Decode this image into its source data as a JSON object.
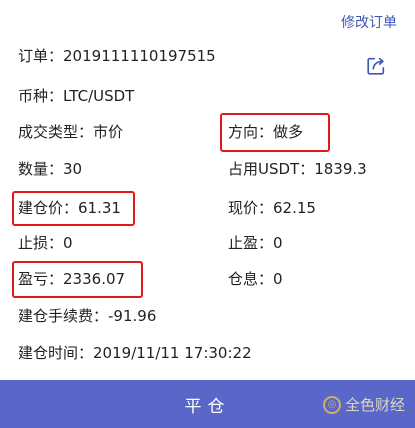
{
  "header": {
    "modify_order": "修改订单"
  },
  "icons": {
    "edit": "share-edit-icon"
  },
  "order": {
    "order_id": {
      "label": "订单：",
      "value": "2019111110197515"
    },
    "coin": {
      "label": "币种：",
      "value": "LTC/USDT"
    },
    "trade_type": {
      "label": "成交类型：",
      "value": "市价"
    },
    "direction": {
      "label": "方向：",
      "value": "做多"
    },
    "quantity": {
      "label": "数量：",
      "value": "30"
    },
    "usdt_used": {
      "label": "占用USDT：",
      "value": "1839.3"
    },
    "open_price": {
      "label": "建仓价：",
      "value": "61.31"
    },
    "current_price": {
      "label": "现价：",
      "value": "62.15"
    },
    "stop_loss": {
      "label": "止损：",
      "value": "0"
    },
    "take_profit": {
      "label": "止盈：",
      "value": "0"
    },
    "pnl": {
      "label": "盈亏：",
      "value": "2336.07"
    },
    "position_interest": {
      "label": "仓息：",
      "value": "0"
    },
    "open_fee": {
      "label": "建仓手续费：",
      "value": "-91.96"
    },
    "open_time": {
      "label": "建仓时间：",
      "value": "2019/11/11 17:30:22"
    }
  },
  "actions": {
    "close_position": "平仓"
  },
  "watermark": {
    "text": "全色财经"
  },
  "colors": {
    "accent": "#5a66c8",
    "highlight": "#e0191b",
    "link": "#3f57b8"
  }
}
